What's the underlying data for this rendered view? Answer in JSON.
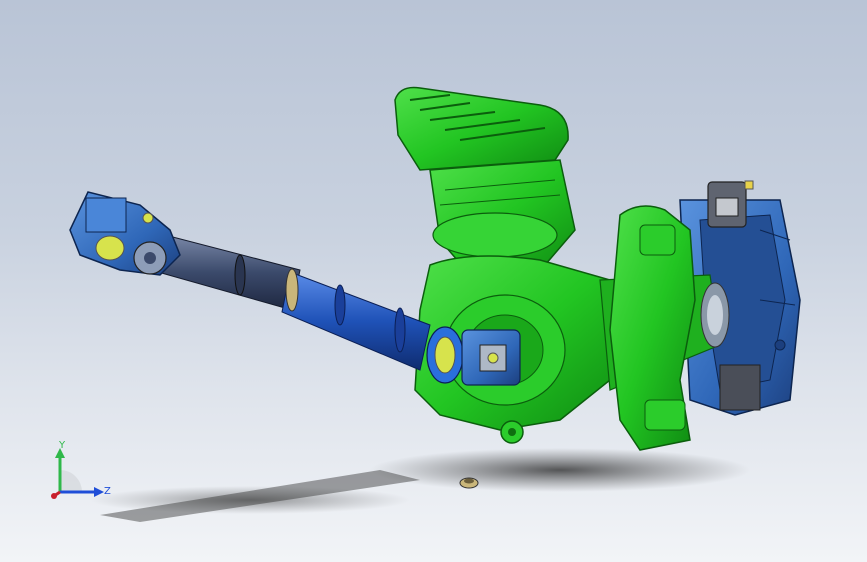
{
  "viewport": {
    "background_top": "#b9c4d6",
    "background_bottom": "#f2f4f7"
  },
  "model": {
    "colors": {
      "housing_green": "#22c522",
      "housing_dark_green": "#129412",
      "bracket_blue": "#2f67b8",
      "shaft_dark": "#3b4a6b",
      "shaft_blue": "#1f52b8",
      "joint_blue": "#2e7fd6",
      "accent_yellow": "#d7e34c"
    }
  },
  "triad": {
    "y_label": "Y",
    "z_label": "Z",
    "y_color": "#2fb84a",
    "z_color": "#1f4ed8",
    "x_color": "#c8202c"
  }
}
